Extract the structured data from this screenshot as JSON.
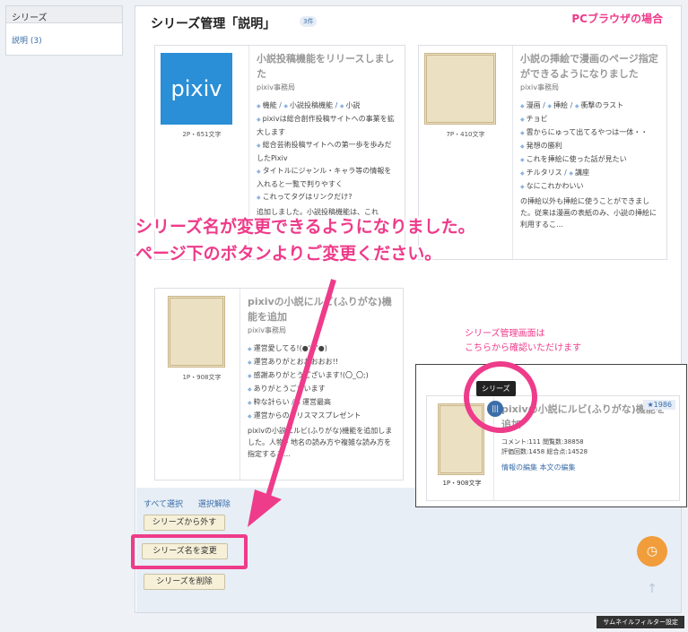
{
  "sidebar": {
    "header": "シリーズ",
    "item": "説明 (3)"
  },
  "page": {
    "title": "シリーズ管理「説明」",
    "count": "3件",
    "platform_note": "PCブラウザの場合"
  },
  "cards": [
    {
      "title": "小説投稿機能をリリースしました",
      "author": "pixiv事務局",
      "meta": "2P・651文字",
      "thumb": "pixiv",
      "tags": [
        "機能",
        "小説投稿機能",
        "小説",
        "pixivは総合創作投稿サイトへの事業を拡大します",
        "総合芸術投稿サイトへの第一歩を歩みだしたPixiv",
        "タイトルにジャンル・キャラ等の情報を入れると一覧で判りやすく",
        "これってタグはリンクだけ?"
      ],
      "desc": "追加しました。小説投稿機能は、これ"
    },
    {
      "title": "小説の挿絵で漫画のページ指定ができるようになりました",
      "author": "pixiv事務局",
      "meta": "7P・410文字",
      "tags": [
        "漫画",
        "挿絵",
        "衝撃のラスト",
        "チョビ",
        "雲からにゅって出てるやつは一体・・",
        "発想の勝利",
        "これを挿絵に使った話が見たい",
        "チルタリス",
        "講座",
        "なにこれかわいい"
      ],
      "desc": "の挿絵以外も挿絵に使うことができました。従来は漫画の表紙のみ、小説の挿絵に利用するこ…"
    },
    {
      "title": "pixivの小説にルビ(ふりがな)機能を追加",
      "author": "pixiv事務局",
      "meta": "1P・908文字",
      "tags": [
        "運営愛してる!(●'ω'●)",
        "運営ありがとおおおおお!!",
        "感謝ありがとうございます!(〇_〇;)",
        "ありがとうございます",
        "粋な計らい",
        "運営最高",
        "運営からのクリスマスプレゼント"
      ],
      "desc": "pixivの小説にルビ(ふりがな)機能を追加しました。人物・地名の読み方や複雑な読み方を指定するこ…"
    }
  ],
  "actions": {
    "select_all": "すべて選択",
    "deselect": "選択解除",
    "remove": "シリーズから外す",
    "rename": "シリーズ名を変更",
    "delete": "シリーズを削除"
  },
  "overlay": {
    "line1": "シリーズ名が変更できるようになりました。",
    "line2": "ページ下のボタンよりご変更ください。",
    "inset_note_1": "シリーズ管理画面は",
    "inset_note_2": "こちらから確認いただけます"
  },
  "inset": {
    "tooltip": "シリーズ",
    "title": "pixivの小説にルビ(ふりがな)機能を追加",
    "rank": "★1986",
    "comment": "コメント:111",
    "views": "閲覧数:38858",
    "rating_count": "評価回数:1458",
    "total": "総合点:14528",
    "meta": "1P・908文字",
    "edit_info": "情報の編集",
    "edit_body": "本文の編集"
  },
  "footer": {
    "filter_label": "サムネイルフィルター設定"
  },
  "colors": {
    "accent": "#ee3b8a",
    "link": "#3b6ea8"
  }
}
